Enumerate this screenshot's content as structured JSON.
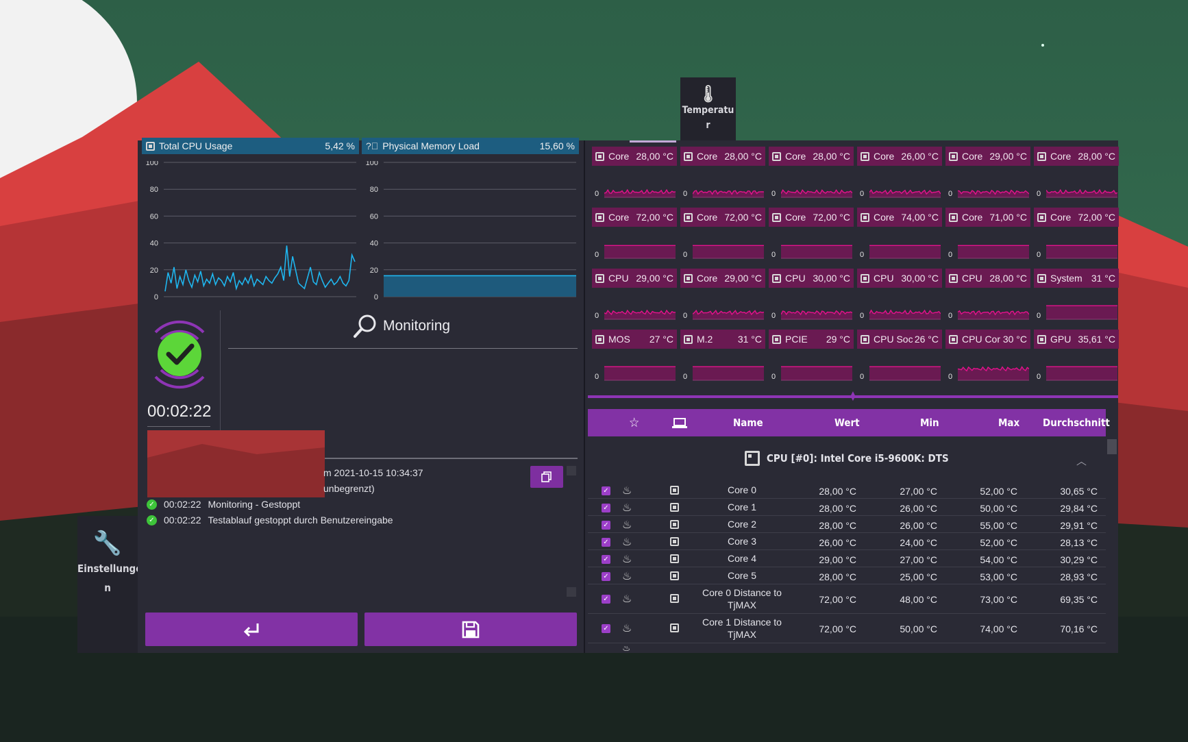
{
  "sidebar": {
    "temperature_label_line1": "Temperatu",
    "temperature_label_line2": "r",
    "settings_label_line1": "Einstellunge",
    "settings_label_line2": "n"
  },
  "cpu_usage": {
    "label": "Total CPU Usage",
    "value": "5,42 %",
    "y_ticks": [
      "100",
      "80",
      "60",
      "40",
      "20",
      "0"
    ],
    "samples": [
      4,
      18,
      10,
      22,
      6,
      15,
      9,
      20,
      12,
      7,
      16,
      11,
      19,
      8,
      13,
      10,
      17,
      9,
      14,
      12,
      8,
      15,
      11,
      18,
      6,
      12,
      9,
      14,
      10,
      16,
      8,
      13,
      11,
      9,
      15,
      12,
      10,
      14,
      17,
      22,
      12,
      38,
      15,
      30,
      20,
      10,
      8,
      6,
      14,
      22,
      11,
      9,
      18,
      12,
      7,
      10,
      13,
      9,
      11,
      15,
      10,
      8,
      12,
      31,
      26
    ]
  },
  "memory_load": {
    "label": "Physical Memory Load",
    "value": "15,60 %",
    "y_ticks": [
      "100",
      "80",
      "60",
      "40",
      "20",
      "0"
    ],
    "level": 15.6
  },
  "monitor": {
    "timer": "00:02:22",
    "title": "Monitoring"
  },
  "log": {
    "line1": "m 2021-10-15 10:34:37",
    "line2": "unbegrenzt)",
    "line3_time": "00:02:22",
    "line3_text": "Monitoring - Gestoppt",
    "line4_time": "00:02:22",
    "line4_text": "Testablauf gestoppt durch Benutzereingabe"
  },
  "sensor_tiles": [
    {
      "label": "Core",
      "value": "28,00 °C",
      "zero": "0",
      "kind": "noisy",
      "level": 0.35
    },
    {
      "label": "Core",
      "value": "28,00 °C",
      "zero": "0",
      "kind": "noisy",
      "level": 0.35
    },
    {
      "label": "Core",
      "value": "28,00 °C",
      "zero": "0",
      "kind": "noisy",
      "level": 0.35
    },
    {
      "label": "Core",
      "value": "26,00 °C",
      "zero": "0",
      "kind": "noisy",
      "level": 0.35
    },
    {
      "label": "Core",
      "value": "29,00 °C",
      "zero": "0",
      "kind": "noisy",
      "level": 0.35
    },
    {
      "label": "Core",
      "value": "28,00 °C",
      "zero": "0",
      "kind": "noisy",
      "level": 0.35
    },
    {
      "label": "Core",
      "value": "72,00 °C",
      "zero": "0",
      "kind": "flat",
      "level": 0.85
    },
    {
      "label": "Core",
      "value": "72,00 °C",
      "zero": "0",
      "kind": "flat",
      "level": 0.85
    },
    {
      "label": "Core",
      "value": "72,00 °C",
      "zero": "0",
      "kind": "flat",
      "level": 0.85
    },
    {
      "label": "Core",
      "value": "74,00 °C",
      "zero": "0",
      "kind": "flat",
      "level": 0.85
    },
    {
      "label": "Core",
      "value": "71,00 °C",
      "zero": "0",
      "kind": "flat",
      "level": 0.85
    },
    {
      "label": "Core",
      "value": "72,00 °C",
      "zero": "0",
      "kind": "flat",
      "level": 0.85
    },
    {
      "label": "CPU",
      "value": "29,00 °C",
      "zero": "0",
      "kind": "noisy",
      "level": 0.45
    },
    {
      "label": "Core",
      "value": "29,00 °C",
      "zero": "0",
      "kind": "noisy",
      "level": 0.45
    },
    {
      "label": "CPU",
      "value": "30,00 °C",
      "zero": "0",
      "kind": "noisy",
      "level": 0.45
    },
    {
      "label": "CPU",
      "value": "30,00 °C",
      "zero": "0",
      "kind": "noisy",
      "level": 0.45
    },
    {
      "label": "CPU",
      "value": "28,00 °C",
      "zero": "0",
      "kind": "noisy",
      "level": 0.45
    },
    {
      "label": "System",
      "value": "31 °C",
      "zero": "0",
      "kind": "flat",
      "level": 0.9
    },
    {
      "label": "MOS",
      "value": "27 °C",
      "zero": "0",
      "kind": "flat",
      "level": 0.9
    },
    {
      "label": "M.2",
      "value": "31 °C",
      "zero": "0",
      "kind": "flat",
      "level": 0.9
    },
    {
      "label": "PCIE",
      "value": "29 °C",
      "zero": "0",
      "kind": "flat",
      "level": 0.9
    },
    {
      "label": "CPU Soc",
      "value": "26 °C",
      "zero": "0",
      "kind": "flat",
      "level": 0.9
    },
    {
      "label": "CPU Cor",
      "value": "30 °C",
      "zero": "0",
      "kind": "noisy",
      "level": 0.75
    },
    {
      "label": "GPU",
      "value": "35,61 °C",
      "zero": "0",
      "kind": "flat",
      "level": 0.9
    }
  ],
  "table": {
    "headers": {
      "name": "Name",
      "value": "Wert",
      "min": "Min",
      "max": "Max",
      "avg": "Durchschnitt"
    },
    "group_title": "CPU [#0]: Intel Core i5-9600K: DTS",
    "rows": [
      {
        "name": "Core 0",
        "value": "28,00 °C",
        "min": "27,00 °C",
        "max": "52,00 °C",
        "avg": "30,65 °C"
      },
      {
        "name": "Core 1",
        "value": "28,00 °C",
        "min": "26,00 °C",
        "max": "50,00 °C",
        "avg": "29,84 °C"
      },
      {
        "name": "Core 2",
        "value": "28,00 °C",
        "min": "26,00 °C",
        "max": "55,00 °C",
        "avg": "29,91 °C"
      },
      {
        "name": "Core 3",
        "value": "26,00 °C",
        "min": "24,00 °C",
        "max": "52,00 °C",
        "avg": "28,13 °C"
      },
      {
        "name": "Core 4",
        "value": "29,00 °C",
        "min": "27,00 °C",
        "max": "54,00 °C",
        "avg": "30,29 °C"
      },
      {
        "name": "Core 5",
        "value": "28,00 °C",
        "min": "25,00 °C",
        "max": "53,00 °C",
        "avg": "28,93 °C"
      },
      {
        "name": "Core 0 Distance to TjMAX",
        "value": "72,00 °C",
        "min": "48,00 °C",
        "max": "73,00 °C",
        "avg": "69,35 °C"
      },
      {
        "name": "Core 1 Distance to TjMAX",
        "value": "72,00 °C",
        "min": "50,00 °C",
        "max": "74,00 °C",
        "avg": "70,16 °C"
      }
    ]
  },
  "colors": {
    "accent": "#8232a5",
    "tile": "#6a1a52",
    "spark": "#e4128c",
    "cpu_line": "#1fb6ef",
    "ok": "#3ec43a",
    "header_blue": "#1d5d80"
  }
}
